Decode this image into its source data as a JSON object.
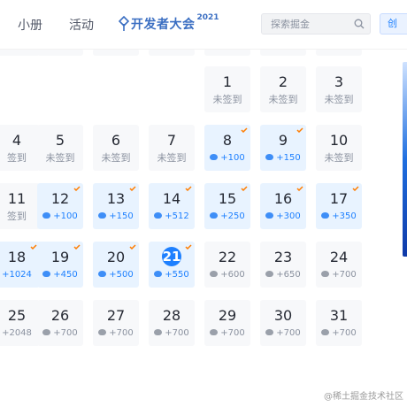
{
  "header": {
    "nav": [
      "小册",
      "活动"
    ],
    "devconf": {
      "text": "开发者大会",
      "year": "2021"
    },
    "search_placeholder": "探索掘金",
    "create_label": "创"
  },
  "calendar": {
    "weeks": [
      [
        null,
        null,
        null,
        null,
        {
          "day": "1",
          "status": "未签到"
        },
        {
          "day": "2",
          "status": "未签到"
        },
        {
          "day": "3",
          "status": "未签到"
        }
      ],
      [
        {
          "day": "4",
          "status": "签到"
        },
        {
          "day": "5",
          "status": "未签到"
        },
        {
          "day": "6",
          "status": "未签到"
        },
        {
          "day": "7",
          "status": "未签到"
        },
        {
          "day": "8",
          "points": "+100",
          "signed": true
        },
        {
          "day": "9",
          "points": "+150",
          "signed": true
        },
        {
          "day": "10",
          "status": "未签到"
        }
      ],
      [
        {
          "day": "11",
          "status": "签到"
        },
        {
          "day": "12",
          "points": "+100",
          "signed": true
        },
        {
          "day": "13",
          "points": "+150",
          "signed": true
        },
        {
          "day": "14",
          "points": "+512",
          "signed": true
        },
        {
          "day": "15",
          "points": "+250",
          "signed": true
        },
        {
          "day": "16",
          "points": "+300",
          "signed": true
        },
        {
          "day": "17",
          "points": "+350",
          "signed": true
        }
      ],
      [
        {
          "day": "18",
          "points": "+1024",
          "signed": true,
          "no_ore": true
        },
        {
          "day": "19",
          "points": "+450",
          "signed": true
        },
        {
          "day": "20",
          "points": "+500",
          "signed": true
        },
        {
          "day": "21",
          "points": "+550",
          "signed": true,
          "today": true
        },
        {
          "day": "22",
          "points": "+600"
        },
        {
          "day": "23",
          "points": "+650"
        },
        {
          "day": "24",
          "points": "+700"
        }
      ],
      [
        {
          "day": "25",
          "points": "+2048",
          "no_ore": true
        },
        {
          "day": "26",
          "points": "+700"
        },
        {
          "day": "27",
          "points": "+700"
        },
        {
          "day": "28",
          "points": "+700"
        },
        {
          "day": "29",
          "points": "+700"
        },
        {
          "day": "30",
          "points": "+700"
        },
        {
          "day": "31",
          "points": "+700"
        }
      ]
    ]
  },
  "watermark": "@稀土掘金技术社区",
  "colors": {
    "accent": "#1e80ff",
    "signed_bg": "#e8f3ff",
    "cell_bg": "#f7f8fa",
    "check": "#ff7d00"
  }
}
